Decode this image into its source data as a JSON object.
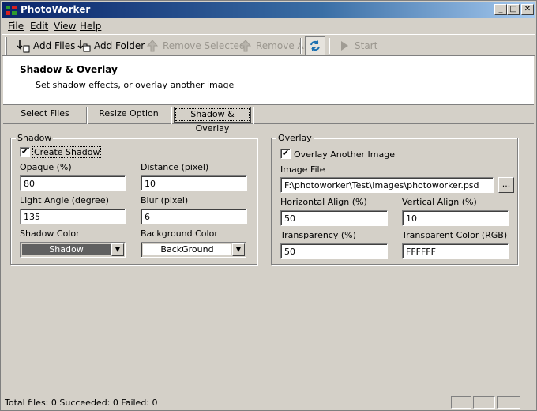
{
  "window": {
    "title": "PhotoWorker",
    "controls": {
      "minimize": "_",
      "maximize": "□",
      "close": "✕"
    }
  },
  "menu": [
    {
      "label": "File"
    },
    {
      "label": "Edit"
    },
    {
      "label": "View"
    },
    {
      "label": "Help"
    }
  ],
  "toolbar": {
    "add_files": "Add Files",
    "add_folder": "Add Folder",
    "remove_selected": "Remove Selected",
    "remove_all": "Remove All",
    "start": "Start",
    "icons": {
      "add_files": "add-files-icon",
      "add_folder": "add-folder-icon",
      "remove_selected": "up-arrow-icon",
      "remove_all": "up-arrow-icon",
      "refresh": "refresh-icon",
      "start": "play-icon"
    }
  },
  "header": {
    "title": "Shadow & Overlay",
    "subtitle": "Set shadow effects, or overlay another image"
  },
  "tabs": [
    {
      "label": "Select Files",
      "active": false
    },
    {
      "label": "Resize Option",
      "active": false
    },
    {
      "label": "Shadow & Overlay",
      "active": true
    }
  ],
  "shadow": {
    "legend": "Shadow",
    "create_shadow_label": "Create Shadow",
    "create_shadow_checked": "✔",
    "opaque_label": "Opaque (%)",
    "opaque_value": "80",
    "distance_label": "Distance (pixel)",
    "distance_value": "10",
    "light_angle_label": "Light Angle (degree)",
    "light_angle_value": "135",
    "blur_label": "Blur (pixel)",
    "blur_value": "6",
    "shadow_color_label": "Shadow Color",
    "shadow_color_value": "Shadow",
    "shadow_color_swatch": "#606060",
    "background_color_label": "Background Color",
    "background_color_value": "BackGround",
    "background_color_swatch": "#ffffff"
  },
  "overlay": {
    "legend": "Overlay",
    "overlay_label": "Overlay Another Image",
    "overlay_checked": "✔",
    "image_file_label": "Image File",
    "image_file_value": "F:\\photoworker\\Test\\Images\\photoworker.psd",
    "browse_label": "...",
    "h_align_label": "Horizontal Align (%)",
    "h_align_value": "50",
    "v_align_label": "Vertical Align (%)",
    "v_align_value": "10",
    "transparency_label": "Transparency (%)",
    "transparency_value": "50",
    "transparent_color_label": "Transparent Color (RGB)",
    "transparent_color_value": "FFFFFF"
  },
  "status": {
    "text": "Total files: 0 Succeeded: 0 Failed: 0"
  }
}
